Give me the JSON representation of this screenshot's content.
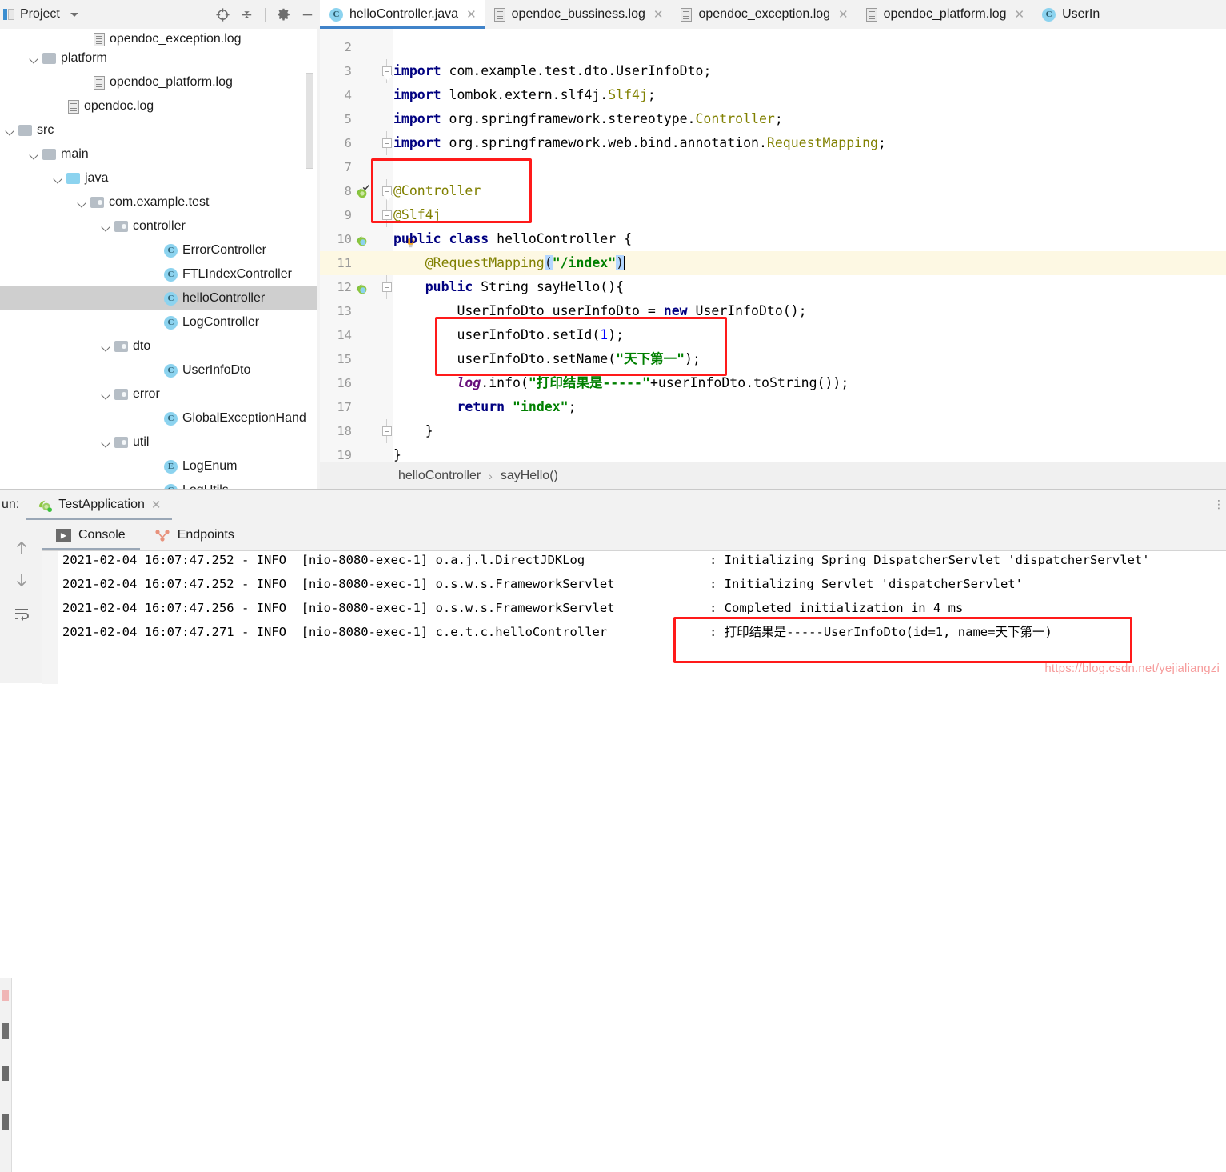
{
  "project_panel": {
    "title": "Project",
    "icons": [
      "locate-icon",
      "collapse-all-icon",
      "gear-icon",
      "minimize-icon"
    ],
    "tree": [
      {
        "label": "opendoc_exception.log",
        "icon": "log-file-icon",
        "indent": 100,
        "arrow": false,
        "clipped": true
      },
      {
        "label": "platform",
        "icon": "folder-icon",
        "indent": 36,
        "arrow": true
      },
      {
        "label": "opendoc_platform.log",
        "icon": "log-file-icon",
        "indent": 100,
        "arrow": false
      },
      {
        "label": "opendoc.log",
        "icon": "log-file-icon",
        "indent": 68,
        "arrow": false
      },
      {
        "label": "src",
        "icon": "folder-icon",
        "indent": 6,
        "arrow": true
      },
      {
        "label": "main",
        "icon": "folder-icon",
        "indent": 36,
        "arrow": true
      },
      {
        "label": "java",
        "icon": "folder-java-icon",
        "indent": 66,
        "arrow": true
      },
      {
        "label": "com.example.test",
        "icon": "package-icon",
        "indent": 96,
        "arrow": true
      },
      {
        "label": "controller",
        "icon": "package-icon",
        "indent": 126,
        "arrow": true
      },
      {
        "label": "ErrorController",
        "icon": "class-icon",
        "indent": 188,
        "arrow": false,
        "badge": "C"
      },
      {
        "label": "FTLIndexController",
        "icon": "class-icon",
        "indent": 188,
        "arrow": false,
        "badge": "C"
      },
      {
        "label": "helloController",
        "icon": "class-icon",
        "indent": 188,
        "arrow": false,
        "badge": "C",
        "selected": true
      },
      {
        "label": "LogController",
        "icon": "class-icon",
        "indent": 188,
        "arrow": false,
        "badge": "C"
      },
      {
        "label": "dto",
        "icon": "package-icon",
        "indent": 126,
        "arrow": true
      },
      {
        "label": "UserInfoDto",
        "icon": "class-icon",
        "indent": 188,
        "arrow": false,
        "badge": "C"
      },
      {
        "label": "error",
        "icon": "package-icon",
        "indent": 126,
        "arrow": true
      },
      {
        "label": "GlobalExceptionHand",
        "icon": "class-icon",
        "indent": 188,
        "arrow": false,
        "badge": "C"
      },
      {
        "label": "util",
        "icon": "package-icon",
        "indent": 126,
        "arrow": true
      },
      {
        "label": "LogEnum",
        "icon": "enum-icon",
        "indent": 188,
        "arrow": false,
        "badge": "E"
      },
      {
        "label": "LogUtils",
        "icon": "class-icon",
        "indent": 188,
        "arrow": false,
        "badge": "C"
      }
    ]
  },
  "editor_tabs": [
    {
      "label": "helloController.java",
      "icon": "class-icon",
      "badge": "C",
      "active": true,
      "closable": true
    },
    {
      "label": "opendoc_bussiness.log",
      "icon": "log-file-icon",
      "active": false,
      "closable": true
    },
    {
      "label": "opendoc_exception.log",
      "icon": "log-file-icon",
      "active": false,
      "closable": true
    },
    {
      "label": "opendoc_platform.log",
      "icon": "log-file-icon",
      "active": false,
      "closable": true
    },
    {
      "label": "UserIn",
      "icon": "class-icon",
      "badge": "C",
      "active": false,
      "closable": false
    }
  ],
  "code": {
    "lines": [
      {
        "num": "2",
        "segments": []
      },
      {
        "num": "3",
        "fold": "top",
        "segments": [
          {
            "t": "import ",
            "c": "kw"
          },
          {
            "t": "com.example.test.dto.",
            "c": "pl"
          },
          {
            "t": "UserInfoDto",
            "c": "pl"
          },
          {
            "t": ";",
            "c": "pl"
          }
        ]
      },
      {
        "num": "4",
        "segments": [
          {
            "t": "import ",
            "c": "kw"
          },
          {
            "t": "lombok.extern.slf4j.",
            "c": "pl"
          },
          {
            "t": "Slf4j",
            "c": "ann"
          },
          {
            "t": ";",
            "c": "pl"
          }
        ]
      },
      {
        "num": "5",
        "segments": [
          {
            "t": "import ",
            "c": "kw"
          },
          {
            "t": "org.springframework.stereotype.",
            "c": "pl"
          },
          {
            "t": "Controller",
            "c": "ann"
          },
          {
            "t": ";",
            "c": "pl"
          }
        ]
      },
      {
        "num": "6",
        "fold": "bot",
        "segments": [
          {
            "t": "import ",
            "c": "kw"
          },
          {
            "t": "org.springframework.web.bind.annotation.",
            "c": "pl"
          },
          {
            "t": "RequestMapping",
            "c": "ann"
          },
          {
            "t": ";",
            "c": "pl"
          }
        ]
      },
      {
        "num": "7",
        "segments": []
      },
      {
        "num": "8",
        "bean": true,
        "fold": "top",
        "segments": [
          {
            "t": "@Controller",
            "c": "ann"
          }
        ]
      },
      {
        "num": "9",
        "fold": "bot",
        "segments": [
          {
            "t": "@Slf4j",
            "c": "ann"
          }
        ]
      },
      {
        "num": "10",
        "bean": true,
        "bulb": true,
        "segments": [
          {
            "t": "public class ",
            "c": "kw"
          },
          {
            "t": "helloController {",
            "c": "pl"
          }
        ]
      },
      {
        "num": "11",
        "current": true,
        "segments": [
          {
            "t": "    @RequestMapping",
            "c": "ann"
          },
          {
            "t": "(",
            "c": "brk"
          },
          {
            "t": "\"/index\"",
            "c": "str"
          },
          {
            "t": ")",
            "c": "brk"
          },
          {
            "t": "|",
            "c": "caret"
          }
        ]
      },
      {
        "num": "12",
        "bean": true,
        "fold": "top2",
        "segments": [
          {
            "t": "    public ",
            "c": "kw"
          },
          {
            "t": "String sayHello(){",
            "c": "pl"
          }
        ]
      },
      {
        "num": "13",
        "segments": [
          {
            "t": "        UserInfoDto userInfoDto = ",
            "c": "pl"
          },
          {
            "t": "new ",
            "c": "kw"
          },
          {
            "t": "UserInfoDto();",
            "c": "pl"
          }
        ]
      },
      {
        "num": "14",
        "segments": [
          {
            "t": "        userInfoDto.setId(",
            "c": "pl"
          },
          {
            "t": "1",
            "c": "num"
          },
          {
            "t": ");",
            "c": "pl"
          }
        ]
      },
      {
        "num": "15",
        "segments": [
          {
            "t": "        userInfoDto.setName(",
            "c": "pl"
          },
          {
            "t": "\"天下第一\"",
            "c": "str"
          },
          {
            "t": ");",
            "c": "pl"
          }
        ]
      },
      {
        "num": "16",
        "segments": [
          {
            "t": "        log",
            "c": "fld"
          },
          {
            "t": ".info(",
            "c": "pl"
          },
          {
            "t": "\"打印结果是-----\"",
            "c": "str"
          },
          {
            "t": "+userInfoDto.toString());",
            "c": "pl"
          }
        ]
      },
      {
        "num": "17",
        "segments": [
          {
            "t": "        return ",
            "c": "kw"
          },
          {
            "t": "\"index\"",
            "c": "str"
          },
          {
            "t": ";",
            "c": "pl"
          }
        ]
      },
      {
        "num": "18",
        "fold": "bot",
        "segments": [
          {
            "t": "    }",
            "c": "pl"
          }
        ]
      },
      {
        "num": "19",
        "segments": [
          {
            "t": "}",
            "c": "pl"
          }
        ]
      }
    ]
  },
  "breadcrumb": {
    "class": "helloController",
    "separator": "›",
    "method": "sayHello()"
  },
  "run_panel": {
    "run_label": "un:",
    "config_name": "TestApplication",
    "tabs": [
      {
        "label": "Console",
        "icon": "console-icon",
        "active": true
      },
      {
        "label": "Endpoints",
        "icon": "endpoints-icon",
        "active": false
      }
    ],
    "rail_icons": [
      "scroll-up-icon",
      "scroll-down-icon",
      "soft-wrap-icon"
    ],
    "console_lines": [
      {
        "left": "2021-02-04 16:07:47.252 - INFO  [nio-8080-exec-1] o.a.j.l.DirectJDKLog",
        "right": ": Initializing Spring DispatcherServlet 'dispatcherServlet'"
      },
      {
        "left": "2021-02-04 16:07:47.252 - INFO  [nio-8080-exec-1] o.s.w.s.FrameworkServlet",
        "right": ": Initializing Servlet 'dispatcherServlet'"
      },
      {
        "left": "2021-02-04 16:07:47.256 - INFO  [nio-8080-exec-1] o.s.w.s.FrameworkServlet",
        "right": ": Completed initialization in 4 ms"
      },
      {
        "left": "2021-02-04 16:07:47.271 - INFO  [nio-8080-exec-1] c.e.t.c.helloController",
        "right": ": 打印结果是-----UserInfoDto(id=1, name=天下第一)"
      }
    ]
  },
  "watermark": "https://blog.csdn.net/yejialiangzi",
  "colors": {
    "accent_tab": "#4083c9",
    "annotation_red": "#ff1a1a",
    "current_line": "#fdf8e3",
    "selection_gray": "#cfcfcf",
    "keyword": "#000080",
    "string": "#008000",
    "annotation_text": "#808000",
    "number": "#0000ff",
    "field": "#660e7a"
  }
}
